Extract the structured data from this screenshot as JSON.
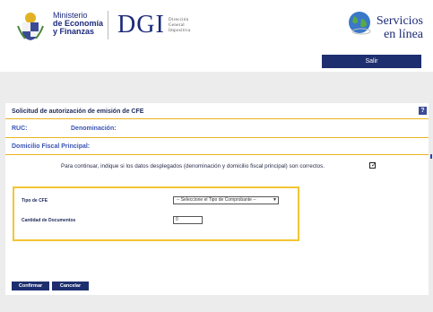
{
  "header": {
    "ministry_line1": "Ministerio",
    "ministry_line2": "de Economía",
    "ministry_line3": "y Finanzas",
    "dgi": "DGI",
    "dgi_sub_line1": "Dirección",
    "dgi_sub_line2": "General",
    "dgi_sub_line3": "Impositiva",
    "servicios_line1": "Servicios",
    "servicios_line2": "en línea",
    "salir_label": "Salir"
  },
  "panel": {
    "title": "Solicitud de autorización de emisión de CFE",
    "help_label": "?",
    "ruc_label": "RUC:",
    "denominacion_label": "Denominación:",
    "domicilio_label": "Domicilio Fiscal Principal:",
    "confirm_text": "Para continuar, indique si los datos desplegados (denominación y domicilio fiscal principal) son correctos.",
    "confirm_checked": true
  },
  "form": {
    "tipo_label": "Tipo de CFE",
    "tipo_selected": "-- Seleccione el Tipo de Comprobante --",
    "cantidad_label": "Cantidad de Documentos",
    "cantidad_value": "0"
  },
  "actions": {
    "confirmar_label": "Confirmar",
    "cancelar_label": "Cancelar"
  },
  "colors": {
    "brand_navy": "#1e2f6f",
    "accent_yellow": "#f3c533",
    "label_blue": "#3a55b5"
  }
}
